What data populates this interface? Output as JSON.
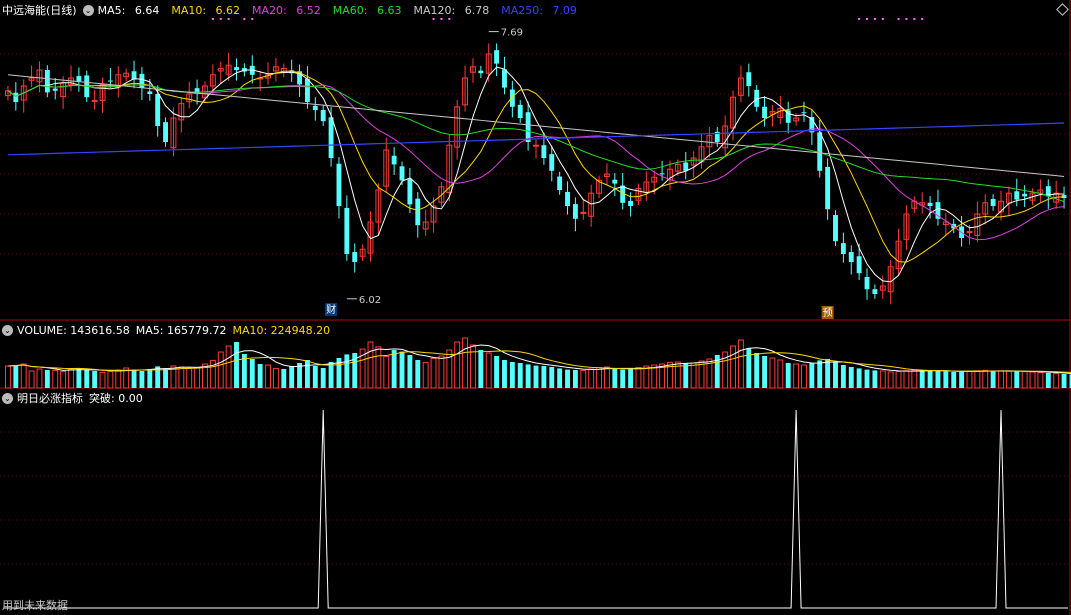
{
  "stock": {
    "name": "中远海能",
    "period": "(日线)"
  },
  "price_header": {
    "items": [
      {
        "label": "MA5:",
        "value": "6.64",
        "color": "#ffffff"
      },
      {
        "label": "MA10:",
        "value": "6.62",
        "color": "#ffd700"
      },
      {
        "label": "MA20:",
        "value": "6.52",
        "color": "#e040e0"
      },
      {
        "label": "MA60:",
        "value": "6.63",
        "color": "#22dd22"
      },
      {
        "label": "MA120:",
        "value": "6.78",
        "color": "#c8c8c8"
      },
      {
        "label": "MA250:",
        "value": "7.09",
        "color": "#3344ff"
      }
    ]
  },
  "volume_header": {
    "title": "VOLUME: 143616.58",
    "ma5": "MA5: 165779.72",
    "ma10": "MA10: 224948.20"
  },
  "indicator_header": {
    "title": "明日必涨指标",
    "signal": "突破: 0.00"
  },
  "footer_text": "用到未来数据",
  "markers": {
    "high_label": "7.69",
    "low_label": "6.02",
    "cai": "财",
    "yu": "预"
  },
  "colors": {
    "up": "#ff3b3b",
    "down": "#54ffff",
    "grid": "#700000",
    "bg": "#000000",
    "vol_ma5": "#ffffff",
    "vol_ma10": "#ffd700"
  },
  "chart_data": [
    {
      "type": "candlestick",
      "title": "中远海能 (日线)",
      "ylim": [
        5.95,
        7.8
      ],
      "high": 7.69,
      "low": 6.02,
      "closes": [
        7.32,
        7.25,
        7.35,
        7.4,
        7.45,
        7.31,
        7.32,
        7.37,
        7.4,
        7.38,
        7.28,
        7.26,
        7.36,
        7.38,
        7.42,
        7.43,
        7.39,
        7.34,
        7.3,
        7.1,
        7.0,
        7.15,
        7.24,
        7.3,
        7.3,
        7.35,
        7.42,
        7.46,
        7.48,
        7.45,
        7.44,
        7.42,
        7.4,
        7.42,
        7.47,
        7.46,
        7.43,
        7.36,
        7.25,
        7.2,
        7.13,
        6.9,
        6.6,
        6.3,
        6.25,
        6.33,
        6.5,
        6.7,
        6.95,
        6.86,
        6.76,
        6.61,
        6.48,
        6.5,
        6.6,
        6.72,
        6.98,
        7.22,
        7.4,
        7.47,
        7.43,
        7.55,
        7.49,
        7.34,
        7.22,
        7.15,
        7.0,
        6.98,
        6.9,
        6.82,
        6.7,
        6.6,
        6.52,
        6.56,
        6.68,
        6.76,
        6.8,
        6.74,
        6.62,
        6.6,
        6.71,
        6.75,
        6.78,
        6.8,
        6.83,
        6.86,
        6.82,
        6.9,
        6.97,
        7.04,
        7.0,
        7.1,
        7.28,
        7.4,
        7.35,
        7.22,
        7.15,
        7.19,
        7.21,
        7.12,
        7.15,
        7.18,
        7.06,
        6.82,
        6.58,
        6.38,
        6.3,
        6.25,
        6.18,
        6.08,
        6.05,
        6.1,
        6.22,
        6.38,
        6.55,
        6.63,
        6.62,
        6.6,
        6.52,
        6.5,
        6.46,
        6.4,
        6.44,
        6.55,
        6.62,
        6.6,
        6.63,
        6.68,
        6.64,
        6.66,
        6.68,
        6.7,
        6.66,
        6.68,
        6.65
      ],
      "series": [
        {
          "name": "MA5",
          "value": 6.64
        },
        {
          "name": "MA10",
          "value": 6.62
        },
        {
          "name": "MA20",
          "value": 6.52
        },
        {
          "name": "MA60",
          "value": 6.63
        },
        {
          "name": "MA120",
          "value": 6.78
        },
        {
          "name": "MA250",
          "value": 7.09
        }
      ]
    },
    {
      "type": "bar",
      "title": "VOLUME",
      "volumes": [
        110,
        115,
        120,
        85,
        95,
        90,
        88,
        82,
        95,
        100,
        90,
        85,
        78,
        82,
        90,
        100,
        92,
        85,
        95,
        108,
        100,
        110,
        105,
        98,
        103,
        120,
        138,
        180,
        210,
        230,
        170,
        145,
        120,
        115,
        98,
        95,
        108,
        125,
        140,
        110,
        100,
        130,
        150,
        168,
        175,
        195,
        230,
        206,
        158,
        190,
        182,
        165,
        140,
        128,
        148,
        160,
        190,
        230,
        250,
        215,
        190,
        175,
        160,
        140,
        130,
        125,
        118,
        112,
        110,
        105,
        98,
        92,
        90,
        88,
        95,
        102,
        105,
        98,
        92,
        95,
        102,
        110,
        115,
        120,
        128,
        130,
        122,
        125,
        135,
        145,
        165,
        180,
        210,
        240,
        200,
        175,
        160,
        150,
        140,
        125,
        120,
        115,
        125,
        138,
        145,
        128,
        115,
        105,
        98,
        92,
        88,
        85,
        80,
        82,
        86,
        90,
        88,
        86,
        85,
        84,
        80,
        82,
        84,
        86,
        88,
        86,
        85,
        84,
        83,
        82,
        80,
        78,
        75,
        72,
        70,
        68
      ],
      "ma5": 165779.72,
      "ma10": 224948.2,
      "current": 143616.58
    },
    {
      "type": "line",
      "title": "明日必涨指标",
      "signal_name": "突破",
      "signal_value": 0.0,
      "spike_candle_indices": [
        40,
        100,
        126
      ]
    }
  ]
}
